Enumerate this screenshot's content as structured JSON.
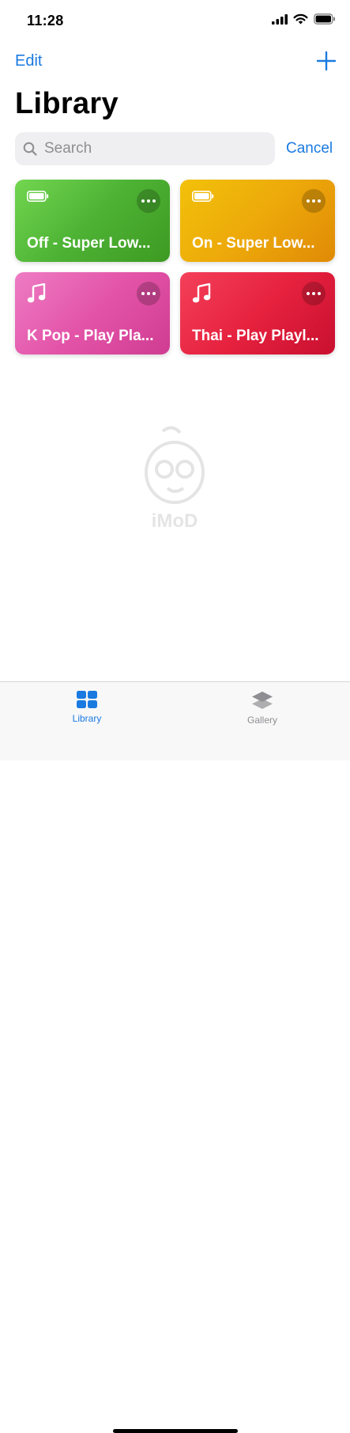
{
  "status_bar": {
    "time": "11:28"
  },
  "nav": {
    "edit_label": "Edit"
  },
  "page": {
    "title": "Library"
  },
  "search": {
    "placeholder": "Search",
    "cancel_label": "Cancel"
  },
  "shortcuts": [
    {
      "label": "Off - Super Low...",
      "icon": "battery-icon",
      "color": "#4db234"
    },
    {
      "label": "On - Super Low...",
      "icon": "battery-icon",
      "color": "#eda90a"
    },
    {
      "label": "K Pop - Play Pla...",
      "icon": "music-note-icon",
      "color": "#e354a8"
    },
    {
      "label": "Thai - Play Playl...",
      "icon": "music-note-icon",
      "color": "#e6223f"
    }
  ],
  "watermark": {
    "text": "iMoD"
  },
  "tab_bar": {
    "tabs": [
      {
        "label": "Library",
        "icon": "library-grid-icon",
        "selected": true
      },
      {
        "label": "Gallery",
        "icon": "gallery-layers-icon",
        "selected": false
      }
    ]
  },
  "colors": {
    "accent": "#1a7ae0"
  }
}
